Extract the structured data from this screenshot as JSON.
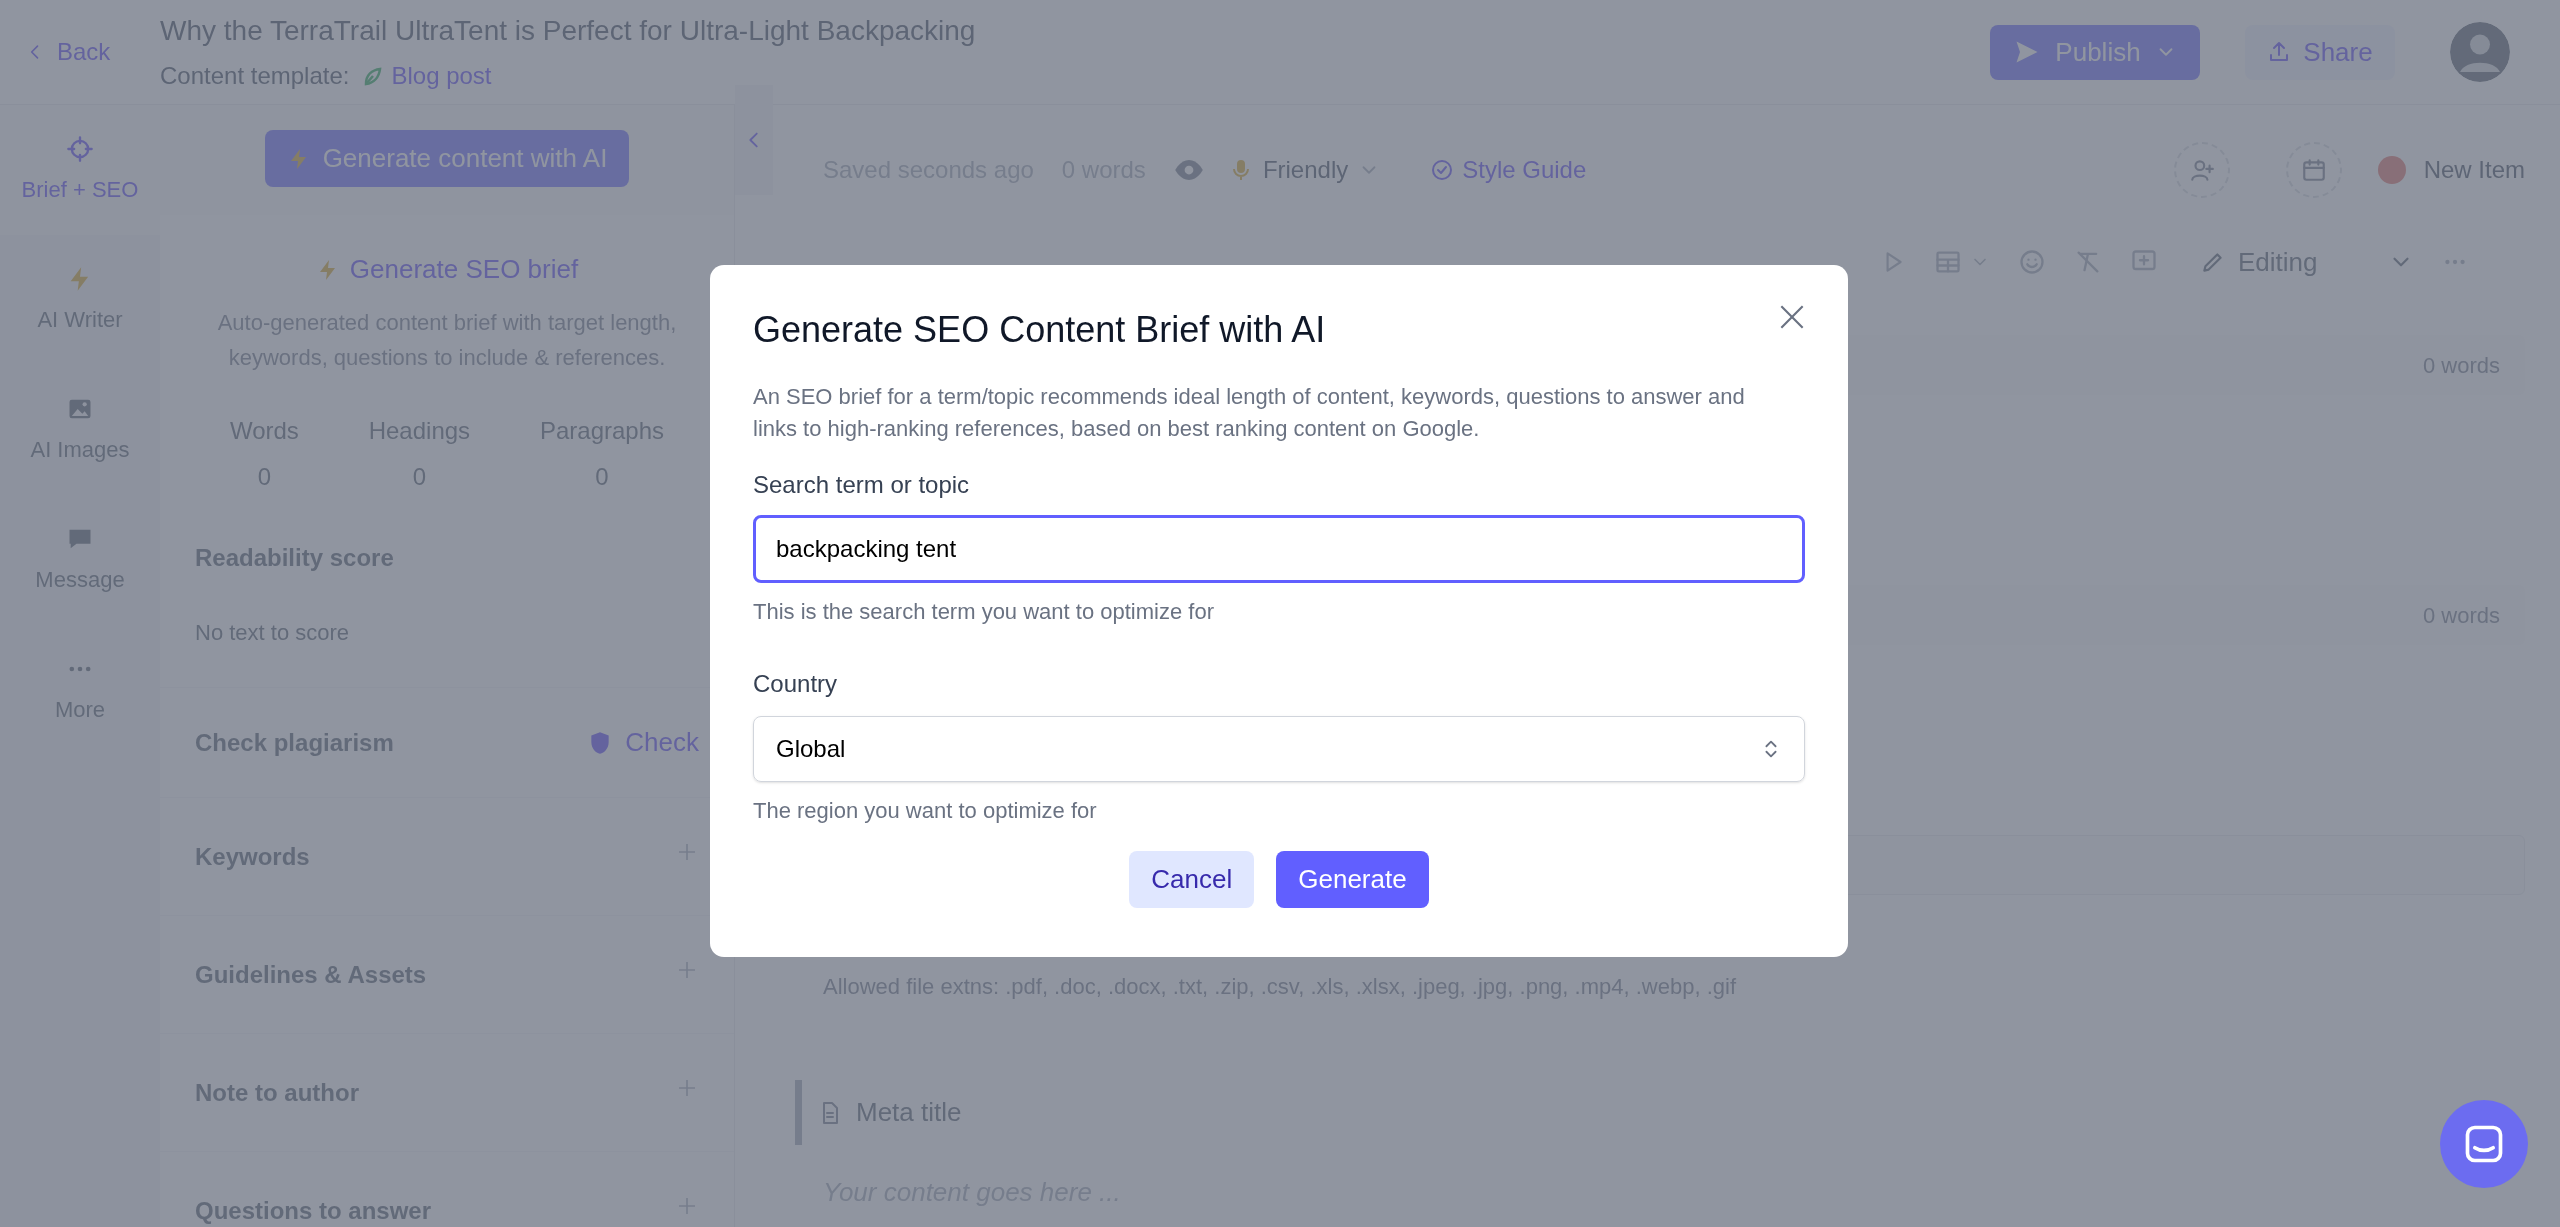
{
  "header": {
    "back": "Back",
    "title": "Why the TerraTrail UltraTent is Perfect for Ultra-Light Backpacking",
    "template_label": "Content template:",
    "template_name": "Blog post",
    "publish": "Publish",
    "share": "Share"
  },
  "nav": [
    {
      "kind": "target",
      "label": "Brief + SEO",
      "selected": true
    },
    {
      "kind": "bolt",
      "label": "AI Writer",
      "selected": false
    },
    {
      "kind": "image",
      "label": "AI Images",
      "selected": false
    },
    {
      "kind": "message",
      "label": "Message",
      "selected": false
    },
    {
      "kind": "more",
      "label": "More",
      "selected": false
    }
  ],
  "sidebar": {
    "generate_button": "Generate content with AI",
    "seo_brief": {
      "title": "Generate SEO brief",
      "description": "Auto-generated content brief with target length, keywords, questions to include & references."
    },
    "stats": [
      {
        "label": "Words",
        "value": "0"
      },
      {
        "label": "Headings",
        "value": "0"
      },
      {
        "label": "Paragraphs",
        "value": "0"
      }
    ],
    "readability": {
      "title": "Readability score",
      "text": "No text to score"
    },
    "plagiarism": {
      "title": "Check plagiarism",
      "action": "Check"
    },
    "sections": [
      "Keywords",
      "Guidelines & Assets",
      "Note to author",
      "Questions to answer"
    ]
  },
  "editor": {
    "status": "Saved seconds ago",
    "word_count": "0 words",
    "tone": "Friendly",
    "style_guide": "Style Guide",
    "item_status": "New Item",
    "mode": "Editing",
    "blocks": [
      {
        "kind": "field",
        "words": "0 words"
      },
      {
        "kind": "field",
        "words": "0 words"
      },
      {
        "kind": "empty"
      },
      {
        "kind": "note",
        "text": "Allowed file extns: .pdf, .doc, .docx, .txt, .zip, .csv, .xls, .xlsx, .jpeg, .jpg, .png, .mp4, .webp, .gif"
      },
      {
        "kind": "meta",
        "title": "Meta title",
        "placeholder": "Your content goes here ..."
      }
    ]
  },
  "modal": {
    "title": "Generate SEO Content Brief with AI",
    "description": "An SEO brief for a term/topic recommends ideal length of content, keywords, questions to answer and links to high-ranking references, based on best ranking content on Google.",
    "search": {
      "label": "Search term or topic",
      "value": "backpacking tent",
      "hint": "This is the search term you want to optimize for"
    },
    "country": {
      "label": "Country",
      "value": "Global",
      "hint": "The region you want to optimize for"
    },
    "buttons": [
      {
        "kind": "secondary",
        "label": "Cancel"
      },
      {
        "kind": "primary",
        "label": "Generate"
      }
    ]
  }
}
